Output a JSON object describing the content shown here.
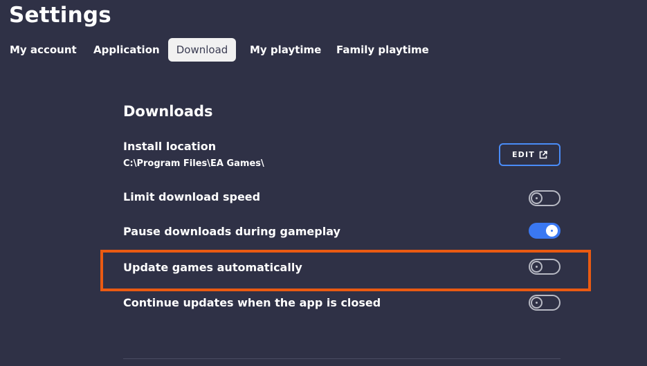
{
  "header": {
    "title": "Settings"
  },
  "tabs": [
    {
      "label": "My account",
      "active": false
    },
    {
      "label": "Application",
      "active": false
    },
    {
      "label": "Download",
      "active": true
    },
    {
      "label": "My playtime",
      "active": false
    },
    {
      "label": "Family playtime",
      "active": false
    }
  ],
  "downloads": {
    "section_title": "Downloads",
    "install_location": {
      "label": "Install location",
      "path": "C:\\Program Files\\EA Games\\",
      "edit_label": "EDIT",
      "edit_icon": "external-link-icon"
    },
    "settings": [
      {
        "label": "Limit download speed",
        "enabled": false
      },
      {
        "label": "Pause downloads during gameplay",
        "enabled": true
      },
      {
        "label": "Update games automatically",
        "enabled": false
      },
      {
        "label": "Continue updates when the app is closed",
        "enabled": false
      }
    ]
  },
  "colors": {
    "background": "#2f3146",
    "accent": "#3a78f2",
    "highlight": "#ea5a12",
    "active_tab_bg": "#f1f1f1"
  }
}
